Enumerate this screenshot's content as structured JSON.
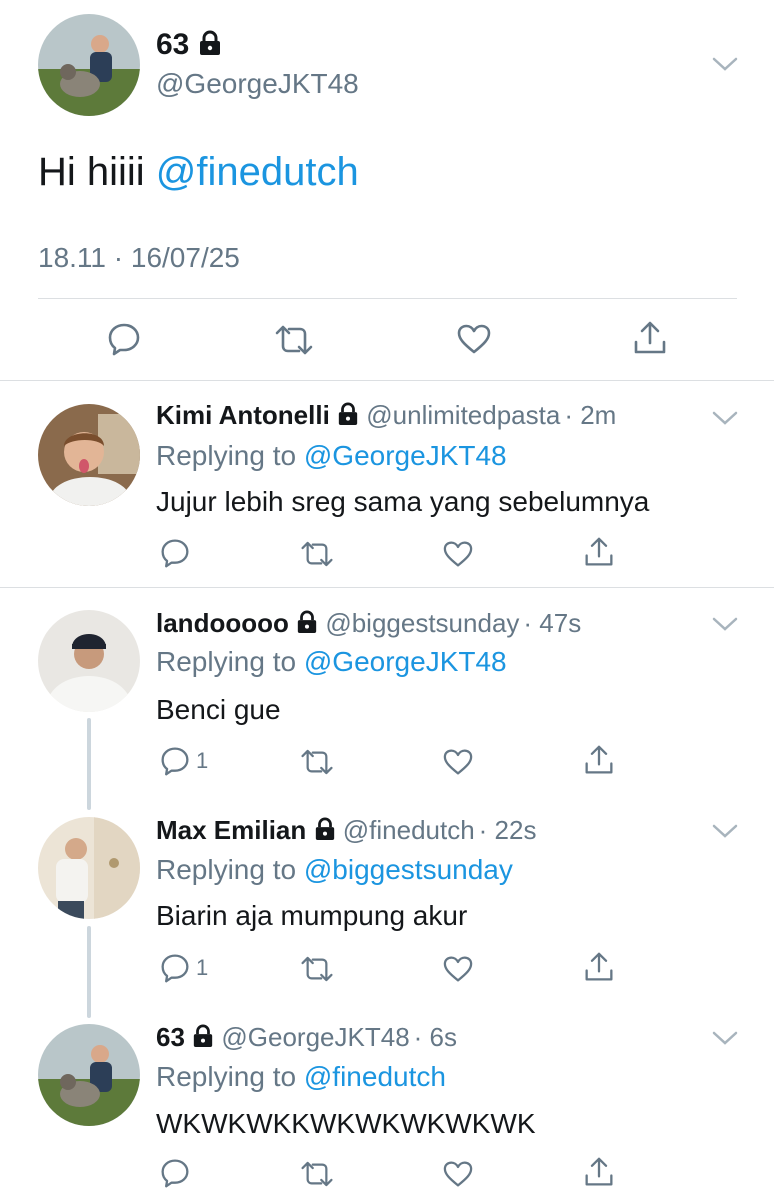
{
  "main_tweet": {
    "display_name": "63",
    "handle": "@GeorgeJKT48",
    "text_prefix": "Hi hiiii ",
    "mention": "@finedutch",
    "timestamp": "18.11 · 16/07/25"
  },
  "replying_label": "Replying to ",
  "replies": [
    {
      "display_name": "Kimi Antonelli",
      "handle": "@unlimitedpasta",
      "time": "· 2m",
      "replying_to": "@GeorgeJKT48",
      "text": "Jujur lebih sreg sama yang sebelumnya",
      "reply_count": ""
    },
    {
      "display_name": "landooooo",
      "handle": "@biggestsunday",
      "time": "· 47s",
      "replying_to": "@GeorgeJKT48",
      "text": "Benci gue",
      "reply_count": "1"
    },
    {
      "display_name": "Max Emilian",
      "handle": "@finedutch",
      "time": "· 22s",
      "replying_to": "@biggestsunday",
      "text": "Biarin aja mumpung akur",
      "reply_count": "1"
    },
    {
      "display_name": "63",
      "handle": "@GeorgeJKT48",
      "time": "· 6s",
      "replying_to": "@finedutch",
      "text": "WKWKWKKWKWKWKWKWK",
      "reply_count": ""
    }
  ],
  "icons": {
    "lock": "lock-icon",
    "chevron": "chevron-down-icon",
    "reply": "reply-icon",
    "retweet": "retweet-icon",
    "like": "heart-icon",
    "share": "share-icon"
  },
  "colors": {
    "link": "#1b95e0",
    "secondary": "#657786",
    "text": "#14171a"
  }
}
